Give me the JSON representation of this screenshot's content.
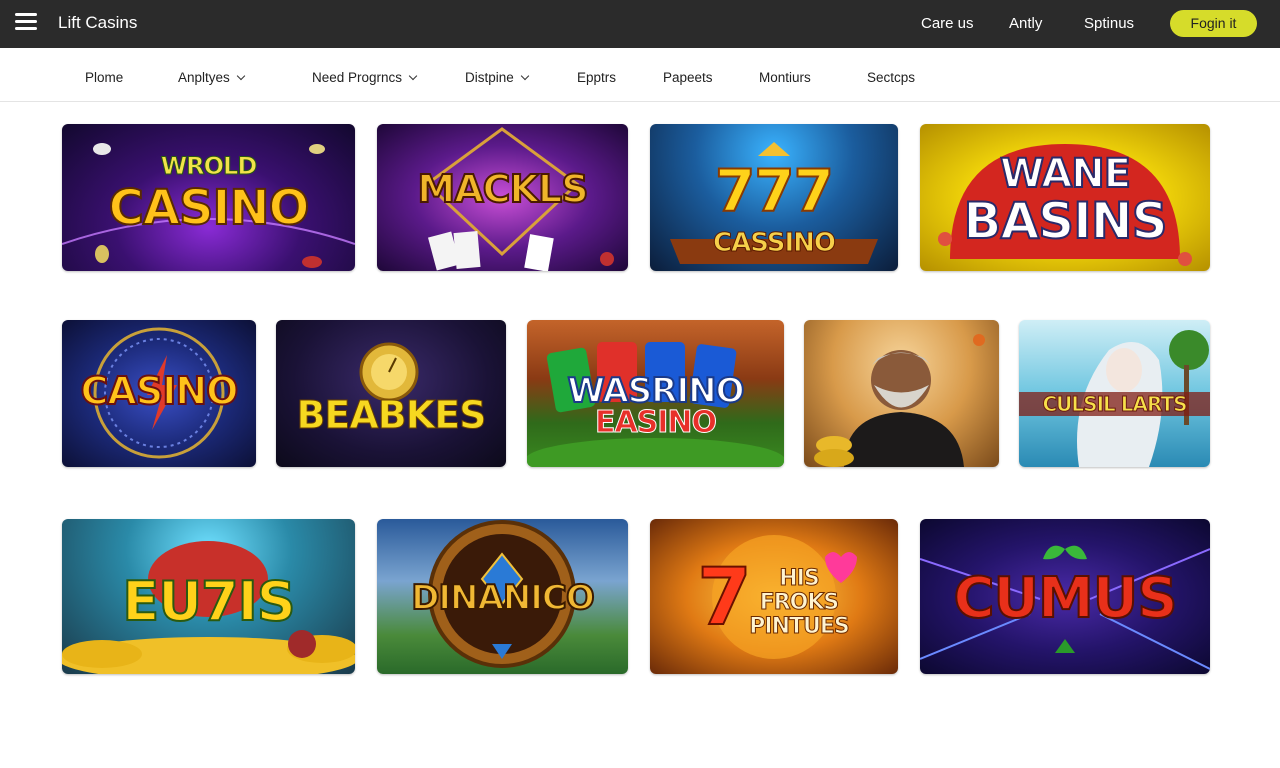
{
  "header": {
    "brand": "Lift Casins",
    "links": [
      "Care us",
      "Antly",
      "Sptinus"
    ],
    "login_label": "Fogin it"
  },
  "subnav": {
    "items": [
      {
        "label": "Plome",
        "dropdown": false
      },
      {
        "label": "Anpltyes",
        "dropdown": true
      },
      {
        "label": "Need Progrncs",
        "dropdown": true
      },
      {
        "label": "Distpine",
        "dropdown": true
      },
      {
        "label": "Epptrs",
        "dropdown": false
      },
      {
        "label": "Papeets",
        "dropdown": false
      },
      {
        "label": "Montiurs",
        "dropdown": false
      },
      {
        "label": "Sectcps",
        "dropdown": false
      }
    ]
  },
  "games": {
    "row1": [
      {
        "line1": "WROLD",
        "line2": "CASINO"
      },
      {
        "line1": "MACKLS",
        "line2": ""
      },
      {
        "line1": "777",
        "line2": "CASSINO"
      },
      {
        "line1": "WANE",
        "line2": "BASINS"
      }
    ],
    "row2": [
      {
        "line1": "CASINO",
        "line2": ""
      },
      {
        "line1": "BEABKES",
        "line2": ""
      },
      {
        "line1": "WASRINO",
        "line2": "EASINO"
      },
      {
        "line1": "",
        "line2": ""
      },
      {
        "line1": "CULSIL LARTS",
        "line2": ""
      }
    ],
    "row3": [
      {
        "line1": "EU7IS",
        "line2": ""
      },
      {
        "line1": "DINANICO",
        "line2": ""
      },
      {
        "line1": "7",
        "line2": "HIS FROKS PINTUES"
      },
      {
        "line1": "CUMUS",
        "line2": ""
      }
    ]
  },
  "colors": {
    "topbar": "#2b2b2b",
    "login": "#d6dc2a"
  }
}
